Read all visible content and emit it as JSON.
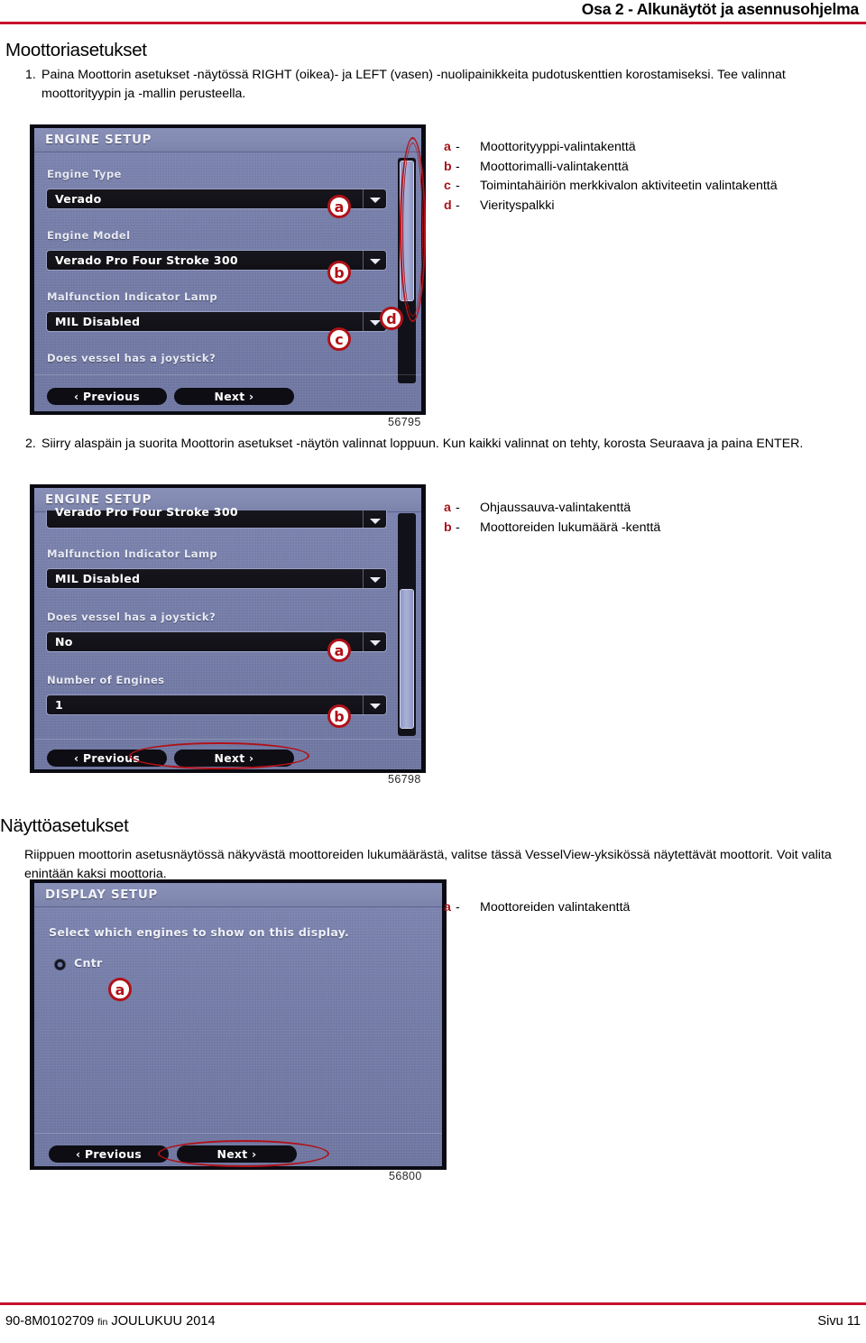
{
  "header": {
    "title": "Osa 2 - Alkunäytöt ja asennusohjelma"
  },
  "sections": [
    {
      "heading": "Moottoriasetukset",
      "steps": [
        {
          "number": "1.",
          "text": "Paina Moottorin asetukset -näytössä RIGHT (oikea)- ja LEFT (vasen) -nuolipainikkeita pudotuskenttien korostamiseksi. Tee valinnat moottorityypin ja -mallin perusteella."
        },
        {
          "number": "2.",
          "text": "Siirry alaspäin ja suorita Moottorin asetukset -näytön valinnat loppuun. Kun kaikki valinnat on tehty, korosta Seuraava ja paina ENTER."
        }
      ]
    },
    {
      "heading": "Näyttöasetukset",
      "body": "Riippuen moottorin asetusnäytössä näkyvästä moottoreiden lukumäärästä, valitse tässä VesselView-yksikössä näytettävät moottorit. Voit valita enintään kaksi moottoria."
    }
  ],
  "figure1": {
    "fignum": "56795",
    "screen": {
      "title": "ENGINE SETUP",
      "fields": [
        {
          "label": "Engine Type",
          "value": "Verado"
        },
        {
          "label": "Engine Model",
          "value": "Verado Pro Four Stroke 300"
        },
        {
          "label": "Malfunction Indicator Lamp",
          "value": "MIL Disabled"
        }
      ],
      "question": "Does vessel has a joystick?",
      "buttons": {
        "previous": "‹ Previous",
        "next": "Next ›"
      }
    },
    "callouts": [
      "a",
      "b",
      "c",
      "d"
    ],
    "legend": [
      {
        "key": "a",
        "dash": "-",
        "label": "Moottorityyppi-valintakenttä"
      },
      {
        "key": "b",
        "dash": "-",
        "label": "Moottorimalli-valintakenttä"
      },
      {
        "key": "c",
        "dash": "-",
        "label": "Toimintahäiriön merkkivalon aktiviteetin valintakenttä"
      },
      {
        "key": "d",
        "dash": "-",
        "label": "Vierityspalkki"
      }
    ]
  },
  "figure2": {
    "fignum": "56798",
    "screen": {
      "title": "ENGINE SETUP",
      "scrolled_value": "Verado Pro Four Stroke 300",
      "fields": [
        {
          "label": "Malfunction Indicator Lamp",
          "value": "MIL Disabled"
        },
        {
          "label": "Does vessel has a joystick?",
          "value": "No"
        },
        {
          "label": "Number of Engines",
          "value": "1"
        }
      ],
      "buttons": {
        "previous": "‹ Previous",
        "next": "Next ›"
      }
    },
    "callouts": [
      "a",
      "b"
    ],
    "legend": [
      {
        "key": "a",
        "dash": "-",
        "label": "Ohjaussauva-valintakenttä"
      },
      {
        "key": "b",
        "dash": "-",
        "label": "Moottoreiden lukumäärä -kenttä"
      }
    ]
  },
  "figure3": {
    "fignum": "56800",
    "screen": {
      "title": "DISPLAY SETUP",
      "prompt": "Select which engines to show on this display.",
      "option": "Cntr",
      "buttons": {
        "previous": "‹ Previous",
        "next": "Next ›"
      }
    },
    "callouts": [
      "a"
    ],
    "legend": [
      {
        "key": "a",
        "dash": "-",
        "label": "Moottoreiden valintakenttä"
      }
    ]
  },
  "footer": {
    "doc_number": "90-8M0102709",
    "language": "fin",
    "month": "JOULUKUU",
    "year": "2014",
    "page_label": "Sivu",
    "page_number": "11"
  },
  "colors": {
    "accent_rule": "#c8102e",
    "callout_red": "#b01118",
    "screen_bg": "#737ba6"
  }
}
